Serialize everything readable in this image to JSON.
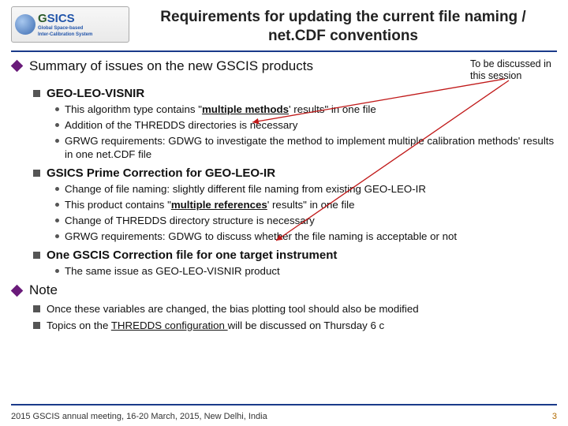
{
  "logo": {
    "main": "SICS",
    "prefix": "G",
    "sub1": "Global Space-based",
    "sub2": "Inter-Calibration System"
  },
  "title": "Requirements for updating the current file naming / net.CDF conventions",
  "summary_heading": "Summary of issues on the new GSCIS products",
  "discuss": "To be discussed in this session",
  "sec1": {
    "head": "GEO-LEO-VISNIR",
    "b1a": "This algorithm type contains \"",
    "b1b": "multiple methods",
    "b1c": "' results\" in one file",
    "b2": "Addition of the THREDDS directories is necessary",
    "b3": "GRWG requirements: GDWG to investigate the method to implement multiple calibration methods' results in one net.CDF file"
  },
  "sec2": {
    "head": "GSICS Prime Correction for GEO-LEO-IR",
    "b1": "Change of file naming: slightly different file naming from existing GEO-LEO-IR",
    "b2a": "This product contains \"",
    "b2b": "multiple references",
    "b2c": "' results\" in one file",
    "b3": "Change of THREDDS directory structure is necessary",
    "b4": "GRWG requirements: GDWG to discuss whether the file naming is acceptable or not"
  },
  "sec3": {
    "head": "One GSCIS Correction file for one target instrument",
    "b1": "The same issue as GEO-LEO-VISNIR product"
  },
  "note": {
    "head": "Note",
    "b1": "Once these variables are changed, the bias plotting tool should also be modified",
    "b2a": "Topics on the ",
    "b2b": "THREDDS configuration ",
    "b2c": "will be discussed on Thursday 6 c"
  },
  "footer": "2015 GSCIS annual meeting, 16-20 March, 2015, New Delhi, India",
  "page": "3"
}
